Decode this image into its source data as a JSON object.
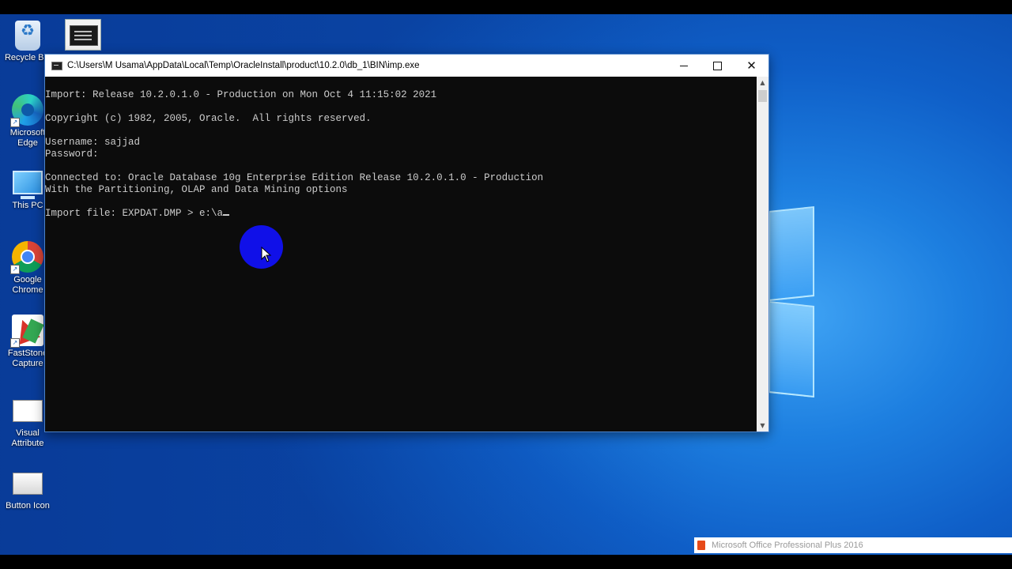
{
  "desktop": {
    "icons": [
      {
        "label": "Recycle Bin"
      },
      {
        "label": "Microsoft Edge"
      },
      {
        "label": "This PC"
      },
      {
        "label": "Google Chrome"
      },
      {
        "label": "FastStone Capture"
      },
      {
        "label": "Visual Attribute"
      },
      {
        "label": "Button Icon"
      }
    ]
  },
  "console": {
    "title": "C:\\Users\\M Usama\\AppData\\Local\\Temp\\OracleInstall\\product\\10.2.0\\db_1\\BIN\\imp.exe",
    "lines": [
      "Import: Release 10.2.0.1.0 - Production on Mon Oct 4 11:15:02 2021",
      "",
      "Copyright (c) 1982, 2005, Oracle.  All rights reserved.",
      "",
      "Username: sajjad",
      "Password:",
      "",
      "Connected to: Oracle Database 10g Enterprise Edition Release 10.2.0.1.0 - Production",
      "With the Partitioning, OLAP and Data Mining options",
      ""
    ],
    "prompt_line": "Import file: EXPDAT.DMP > e:\\a"
  },
  "notification": {
    "text": "Microsoft Office Professional Plus 2016"
  }
}
